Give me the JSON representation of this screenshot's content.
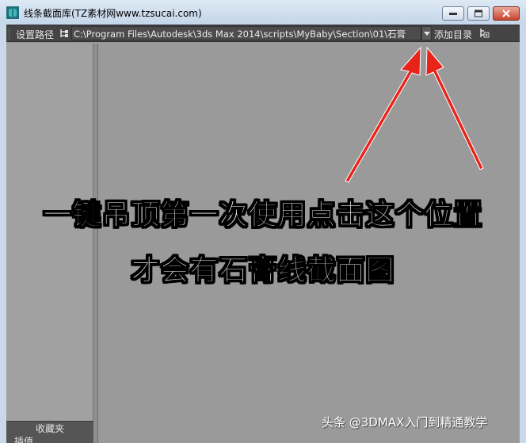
{
  "window": {
    "title": "线条截面库(TZ素材网www.tzsucai.com)",
    "icon": "3dsmax-app-icon"
  },
  "toolbar": {
    "set_path_label": "设置路径",
    "path_value": "C:\\Program Files\\Autodesk\\3ds Max 2014\\scripts\\MyBaby\\Section\\01\\石膏",
    "add_dir_label": "添加目录"
  },
  "sidebar": {
    "favorites_tab": "收藏夹",
    "second_tab": "插值"
  },
  "overlay": {
    "caption_line1": "一键吊顶第一次使用点击这个位置",
    "caption_line2": "才会有石膏线截面图",
    "watermark": "头条 @3DMAX入门到精通教学",
    "arrow_color": "#e8231a"
  }
}
